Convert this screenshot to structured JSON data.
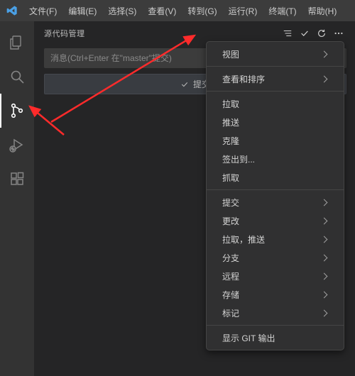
{
  "menubar": {
    "items": [
      "文件(F)",
      "编辑(E)",
      "选择(S)",
      "查看(V)",
      "转到(G)",
      "运行(R)",
      "终端(T)",
      "帮助(H)"
    ]
  },
  "activity": {
    "items": [
      {
        "name": "explorer-icon",
        "active": false
      },
      {
        "name": "search-icon",
        "active": false
      },
      {
        "name": "scm-icon",
        "active": true
      },
      {
        "name": "debug-icon",
        "active": false
      },
      {
        "name": "extensions-icon",
        "active": false
      }
    ]
  },
  "scm": {
    "title": "源代码管理",
    "commit_placeholder": "消息(Ctrl+Enter 在\"master\"提交)",
    "commit_label": "提交"
  },
  "context_menu": {
    "groups": [
      [
        {
          "label": "视图",
          "submenu": true
        }
      ],
      [
        {
          "label": "查看和排序",
          "submenu": true
        }
      ],
      [
        {
          "label": "拉取",
          "submenu": false
        },
        {
          "label": "推送",
          "submenu": false
        },
        {
          "label": "克隆",
          "submenu": false
        },
        {
          "label": "签出到...",
          "submenu": false
        },
        {
          "label": "抓取",
          "submenu": false
        }
      ],
      [
        {
          "label": "提交",
          "submenu": true
        },
        {
          "label": "更改",
          "submenu": true
        },
        {
          "label": "拉取，推送",
          "submenu": true
        },
        {
          "label": "分支",
          "submenu": true
        },
        {
          "label": "远程",
          "submenu": true
        },
        {
          "label": "存储",
          "submenu": true
        },
        {
          "label": "标记",
          "submenu": true
        }
      ],
      [
        {
          "label": "显示 GIT 输出",
          "submenu": false
        }
      ]
    ]
  }
}
